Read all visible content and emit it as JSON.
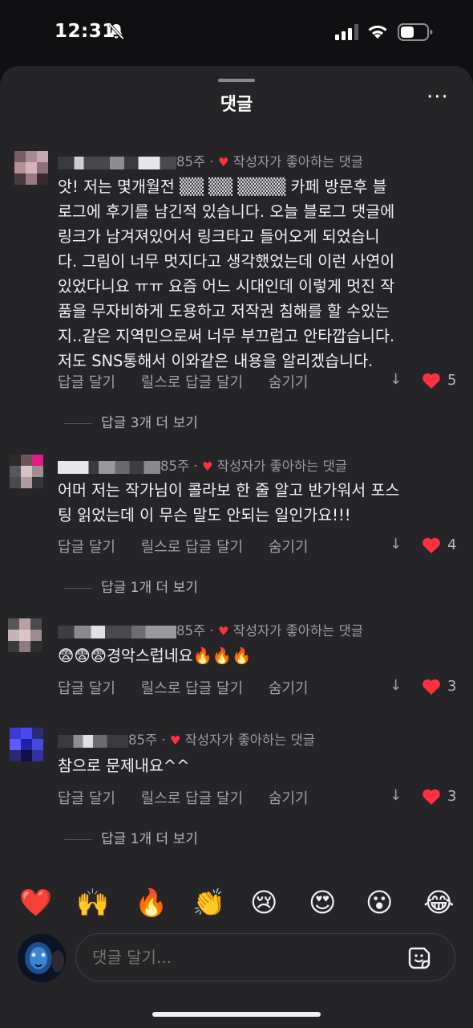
{
  "status_bar": {
    "time": "12:31"
  },
  "sheet": {
    "title": "댓글"
  },
  "comments": [
    {
      "age": "85주",
      "author_liked": "작성자가 좋아하는 댓글",
      "text": "앗! 저는 몇개월전 ▒▒ ▒▒ ▒▒▒▒ 카페 방문후 블\n로그에 후기를 남긴적 있습니다. 오늘 블로그 댓글에\n링크가 남겨져있어서 링크타고 들어오게 되었습니\n다. 그림이 너무 멋지다고 생각했었는데 이런 사연이\n있었다니요 ㅠㅠ 요즘 어느 시대인데 이렇게 멋진 작\n품을 무자비하게 도용하고 저작권 침해를 할 수있는\n지..같은 지역민으로써 너무 부끄럽고 안타깝습니다.\n저도 SNS통해서 이와같은 내용을 알리겠습니다.",
      "reply": "답글 달기",
      "reels_reply": "릴스로 답글 달기",
      "hide": "숨기기",
      "likes": "5",
      "more_replies": "답글 3개 더 보기"
    },
    {
      "age": "85주",
      "author_liked": "작성자가 좋아하는 댓글",
      "text": "어머 저는 작가님이 콜라보 한 줄 알고 반가워서 포스\n팅 읽었는데 이 무슨 말도 안되는 일인가요!!!",
      "reply": "답글 달기",
      "reels_reply": "릴스로 답글 달기",
      "hide": "숨기기",
      "likes": "4",
      "more_replies": "답글 1개 더 보기"
    },
    {
      "age": "85주",
      "author_liked": "작성자가 좋아하는 댓글",
      "text": "😨😨😨경악스럽네요🔥🔥🔥",
      "reply": "답글 달기",
      "reels_reply": "릴스로 답글 달기",
      "hide": "숨기기",
      "likes": "3",
      "more_replies": ""
    },
    {
      "age": "85주",
      "author_liked": "작성자가 좋아하는 댓글",
      "text": "참으로  문제내요^^",
      "reply": "답글 달기",
      "reels_reply": "릴스로 답글 달기",
      "hide": "숨기기",
      "likes": "3",
      "more_replies": "답글 1개 더 보기"
    }
  ],
  "emoji_bar": [
    "❤️",
    "🙌",
    "🔥",
    "👏",
    "😢",
    "😍",
    "😮",
    "😂"
  ],
  "composer": {
    "placeholder": "댓글 달기..."
  },
  "icons": {
    "bell": "bell-slash-icon",
    "signal": "cellular-signal-icon",
    "wifi": "wifi-icon",
    "battery": "battery-icon",
    "more": "more-horizontal-icon",
    "heart": "heart-icon",
    "arrow": "dislike-arrow-icon",
    "sticker": "sticker-icon"
  },
  "colors": {
    "like": "#ff3040",
    "background": "#252528",
    "text": "#f2f2f4",
    "muted": "#9a9aa0"
  }
}
